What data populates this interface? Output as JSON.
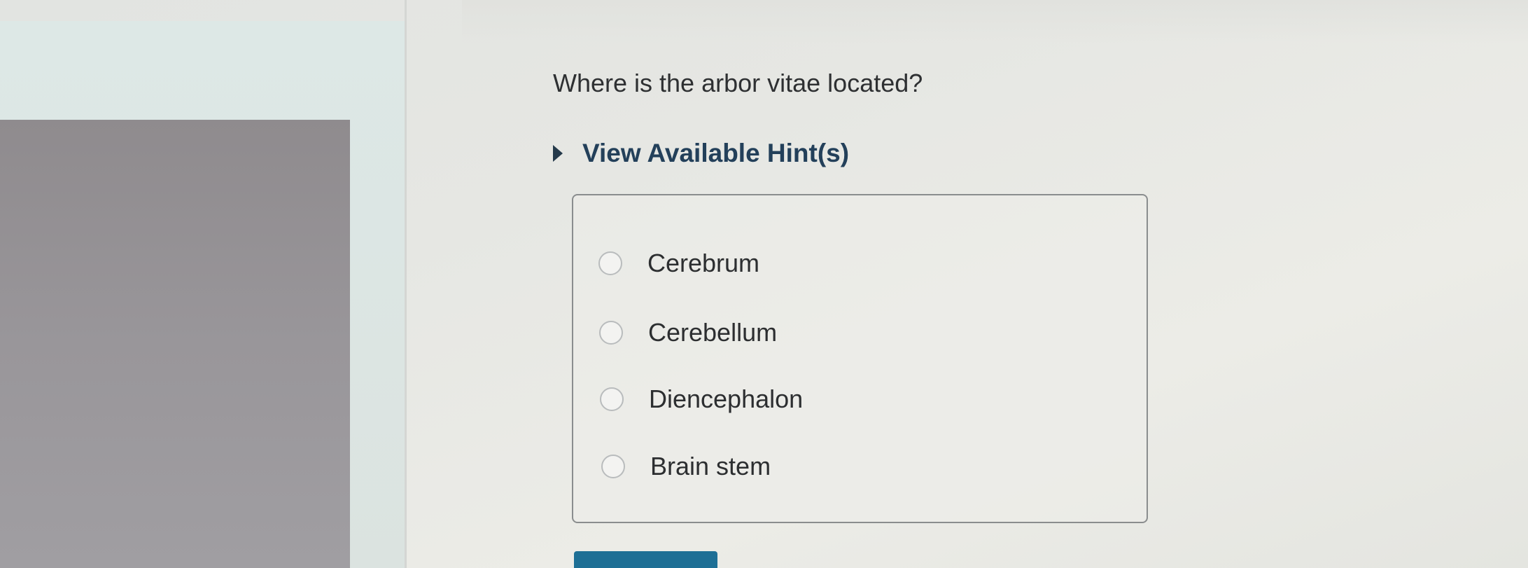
{
  "question": {
    "text": "Where is the arbor vitae located?"
  },
  "hints": {
    "label": "View Available Hint(s)",
    "icon": "caret-right-icon"
  },
  "answer_options": [
    {
      "label": "Cerebrum",
      "selected": false
    },
    {
      "label": "Cerebellum",
      "selected": false
    },
    {
      "label": "Diencephalon",
      "selected": false
    },
    {
      "label": "Brain stem",
      "selected": false
    }
  ],
  "colors": {
    "hint_text": "#23405a",
    "submit_button": "#1e6f95",
    "box_border": "#8a8d8e"
  }
}
